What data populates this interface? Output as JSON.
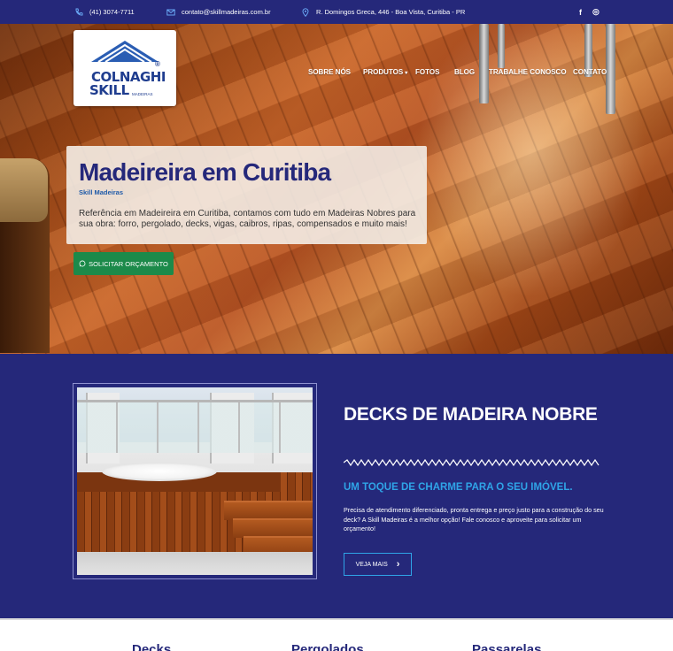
{
  "topbar": {
    "phone": "(41) 3074-7711",
    "email": "contato@skillmadeiras.com.br",
    "address": "R. Domingos Greca, 446 - Boa Vista, Curitiba - PR",
    "social": {
      "facebook": "f",
      "instagram": "◎"
    }
  },
  "logo": {
    "line1": "COLNAGHI",
    "line2": "SKILL",
    "registered": "®",
    "line3": "MADEIRAS"
  },
  "nav": {
    "items": [
      {
        "label": "SOBRE NÓS"
      },
      {
        "label": "PRODUTOS",
        "has_dropdown": true
      },
      {
        "label": "FOTOS"
      },
      {
        "label": "BLOG"
      },
      {
        "label": "TRABALHE CONOSCO"
      },
      {
        "label": "CONTATO"
      }
    ],
    "dropdown_caret": "▾"
  },
  "hero": {
    "title": "Madeireira em Curitiba",
    "subtitle": "Skill Madeiras",
    "text": "Referência em Madeireira em Curitiba, contamos com tudo em Madeiras Nobres para sua obra: forro, pergolado, decks, vigas, caibros, ripas, compensados e muito mais!",
    "cta_label": "SOLICITAR ORÇAMENTO",
    "cta_icon": "whatsapp-icon"
  },
  "decks": {
    "title": "DECKS DE MADEIRA NOBRE",
    "tagline": "UM TOQUE DE CHARME PARA O SEU IMÓVEL.",
    "text": "Precisa de atendimento diferenciado, pronta entrega e preço justo para a construção do seu deck? A Skill Madeiras é a melhor opção! Fale conosco e aproveite para solicitar um orçamento!",
    "button_label": "VEJA MAIS",
    "button_icon": "›"
  },
  "categories": [
    "Decks",
    "Pergolados",
    "Passarelas"
  ],
  "colors": {
    "navy": "#25287a",
    "accent_blue": "#2fa4e7",
    "cta_green": "#1c8a4a"
  }
}
